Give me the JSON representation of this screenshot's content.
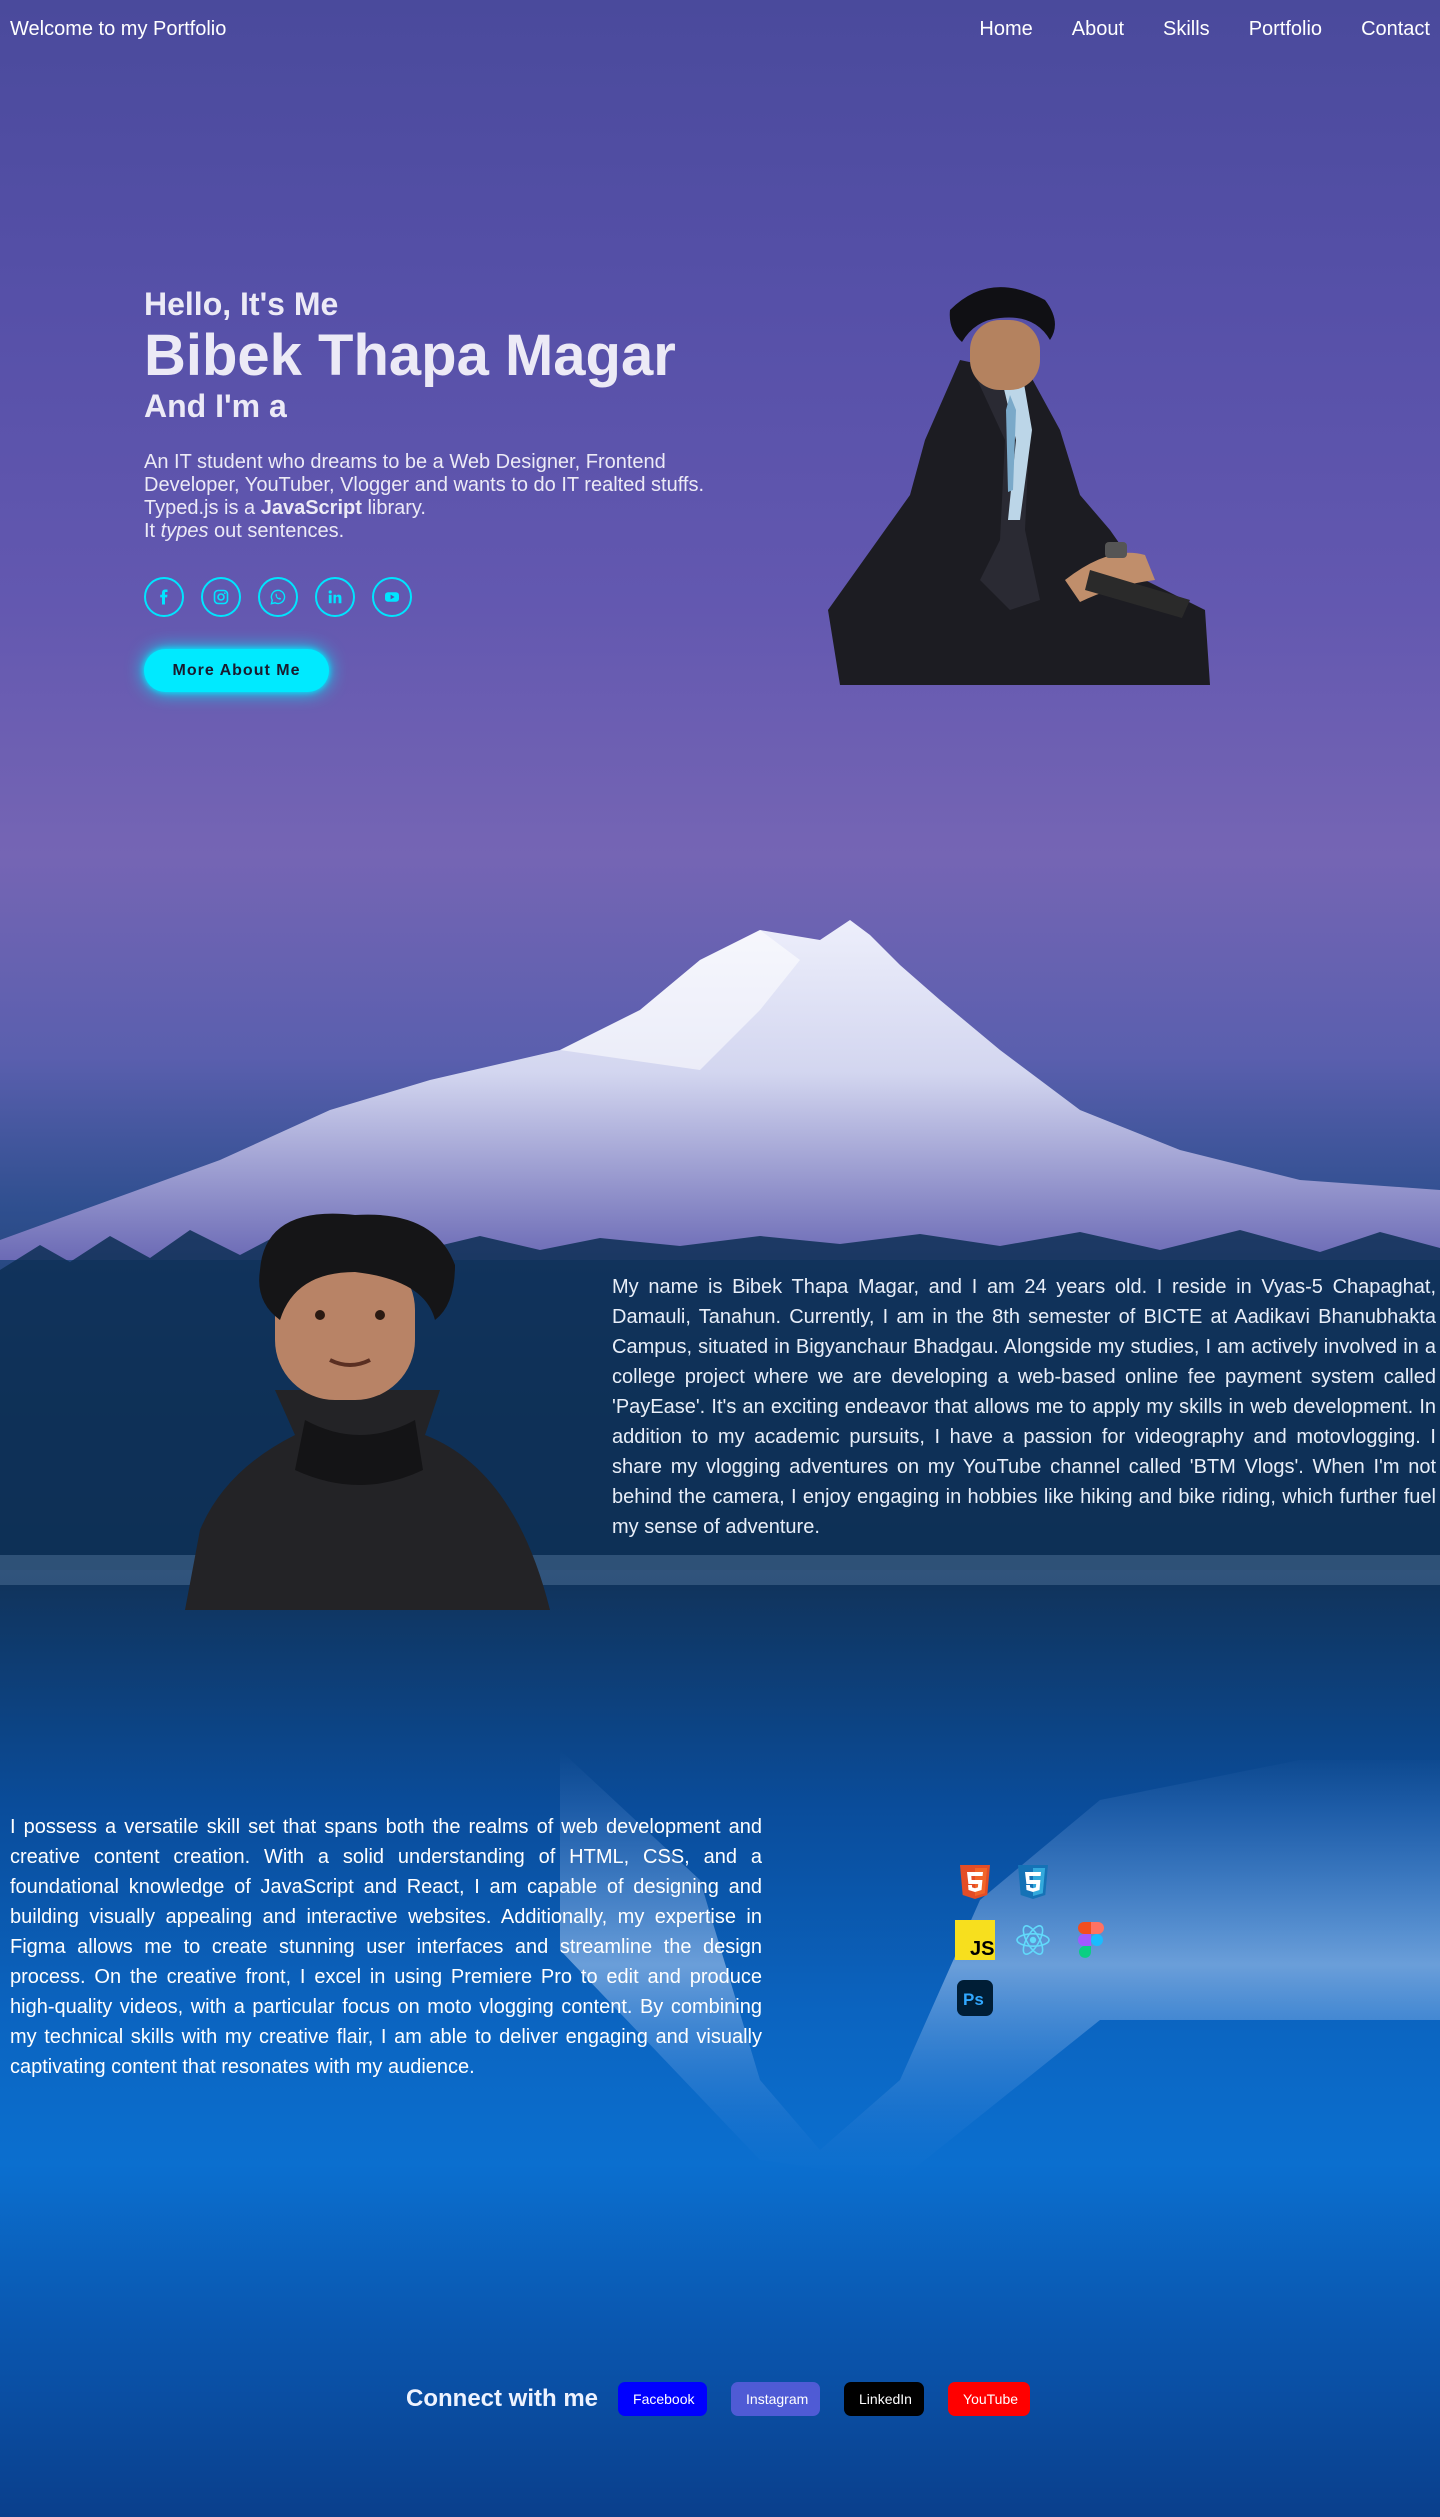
{
  "header": {
    "brand": "Welcome to my Portfolio",
    "nav": [
      "Home",
      "About",
      "Skills",
      "Portfolio",
      "Contact"
    ]
  },
  "hero": {
    "greeting": "Hello, It's Me",
    "name": "Bibek Thapa Magar",
    "role_prefix": "And I'm a",
    "description": "An IT student who dreams to be a Web Designer, Frontend Developer, YouTuber, Vlogger and wants to do IT realted stuffs.",
    "typed_line_1a": "Typed.js is a ",
    "typed_line_1b": "JavaScript",
    "typed_line_1c": " library.",
    "typed_line_2a": "It ",
    "typed_line_2b": "types",
    "typed_line_2c": " out sentences.",
    "socials": [
      "facebook-icon",
      "instagram-icon",
      "whatsapp-icon",
      "linkedin-icon",
      "youtube-icon"
    ],
    "button": "More About Me",
    "accent": "#00eaff"
  },
  "about": {
    "text": "My name is Bibek Thapa Magar, and I am 24 years old. I reside in Vyas-5 Chapaghat, Damauli, Tanahun. Currently, I am in the 8th semester of BICTE at Aadikavi Bhanubhakta Campus, situated in Bigyanchaur Bhadgau. Alongside my studies, I am actively involved in a college project where we are developing a web-based online fee payment system called 'PayEase'. It's an exciting endeavor that allows me to apply my skills in web development. In addition to my academic pursuits, I have a passion for videography and motovlogging. I share my vlogging adventures on my YouTube channel called 'BTM Vlogs'. When I'm not behind the camera, I enjoy engaging in hobbies like hiking and bike riding, which further fuel my sense of adventure."
  },
  "skills": {
    "text": "I possess a versatile skill set that spans both the realms of web development and creative content creation. With a solid understanding of HTML, CSS, and a foundational knowledge of JavaScript and React, I am capable of designing and building visually appealing and interactive websites. Additionally, my expertise in Figma allows me to create stunning user interfaces and streamline the design process. On the creative front, I excel in using Premiere Pro to edit and produce high-quality videos, with a particular focus on moto vlogging content. By combining my technical skills with my creative flair, I am able to deliver engaging and visually captivating content that resonates with my audience.",
    "icons": [
      "html5-icon",
      "css3-icon",
      "javascript-icon",
      "react-icon",
      "figma-icon",
      "photoshop-icon"
    ],
    "js_label": "JS",
    "ps_label": "Ps"
  },
  "connect": {
    "title": "Connect with me",
    "buttons": [
      {
        "label": "Facebook",
        "color": "#0000ff"
      },
      {
        "label": "Instagram",
        "color": "#4f5bd5"
      },
      {
        "label": "LinkedIn",
        "color": "#000000"
      },
      {
        "label": "YouTube",
        "color": "#ff0000"
      }
    ]
  }
}
